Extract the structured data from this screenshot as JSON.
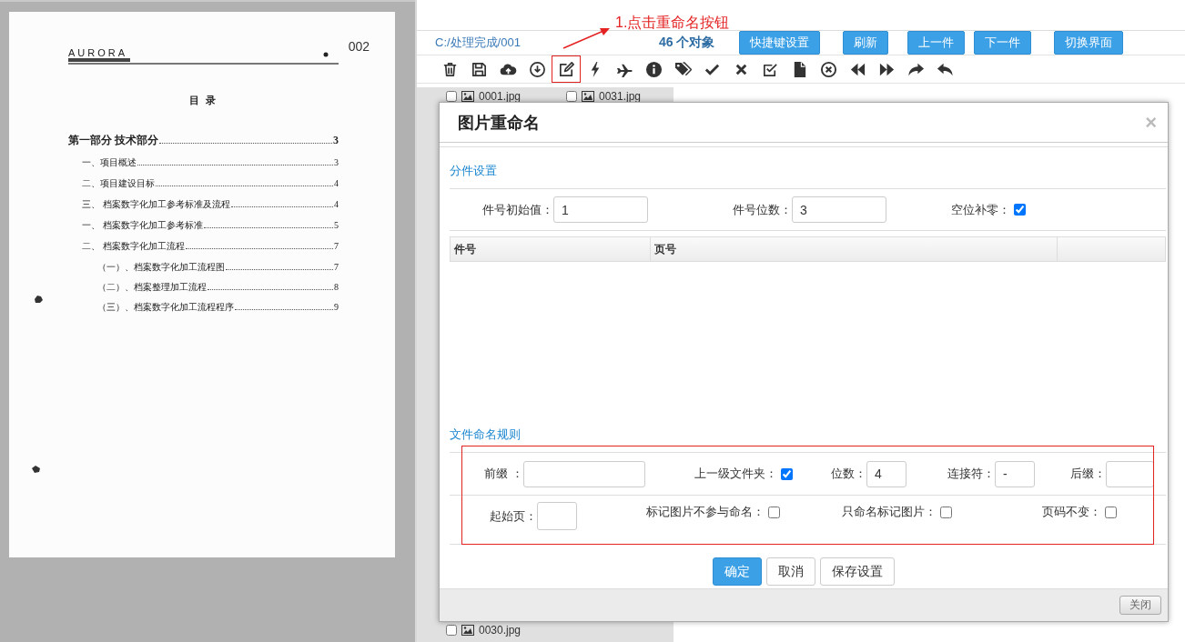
{
  "document_preview": {
    "logo": "AURORA",
    "page_number": "002",
    "title": "目 录",
    "toc": [
      {
        "text": "第一部分 技术部分",
        "page": "3",
        "children": [
          {
            "text": "一、项目概述",
            "page": "3"
          },
          {
            "text": "二、项目建设目标",
            "page": "4"
          },
          {
            "text": "三、 档案数字化加工参考标准及流程",
            "page": "4"
          },
          {
            "text": "一、 档案数字化加工参考标准",
            "page": "5"
          },
          {
            "text": "二、 档案数字化加工流程",
            "page": "7",
            "children": [
              {
                "text": "（一）、档案数字化加工流程图",
                "page": "7"
              },
              {
                "text": "（二）、档案整理加工流程",
                "page": "8"
              },
              {
                "text": "（三）、档案数字化加工流程程序",
                "page": "9"
              }
            ]
          }
        ]
      }
    ]
  },
  "annotation": {
    "text": "1.点击重命名按钮"
  },
  "path": "C:/处理完成/001",
  "count": "46 个对象",
  "buttons": [
    "快捷键设置",
    "刷新",
    "上一件",
    "下一件",
    "切换界面"
  ],
  "toolbar": [
    {
      "kind": "trash",
      "highlighted": false
    },
    {
      "kind": "save",
      "highlighted": false
    },
    {
      "kind": "upload",
      "highlighted": false
    },
    {
      "kind": "download",
      "highlighted": false
    },
    {
      "kind": "edit",
      "highlighted": true
    },
    {
      "kind": "bolt",
      "highlighted": false
    },
    {
      "kind": "plane",
      "highlighted": false
    },
    {
      "kind": "info",
      "highlighted": false
    },
    {
      "kind": "tag",
      "highlighted": false
    },
    {
      "kind": "check",
      "highlighted": false
    },
    {
      "kind": "times",
      "highlighted": false
    },
    {
      "kind": "checksquare",
      "highlighted": false
    },
    {
      "kind": "file",
      "highlighted": false
    },
    {
      "kind": "timescircle",
      "highlighted": false
    },
    {
      "kind": "backward",
      "highlighted": false
    },
    {
      "kind": "forward",
      "highlighted": false
    },
    {
      "kind": "redo",
      "highlighted": false
    },
    {
      "kind": "undo",
      "highlighted": false
    }
  ],
  "files_top": [
    {
      "name": "0001.jpg",
      "checked": false
    },
    {
      "name": "0031.jpg",
      "checked": false
    }
  ],
  "files_bottom": [
    {
      "name": "0030.jpg",
      "checked": false
    }
  ],
  "dialog": {
    "title": "图片重命名",
    "close": "×",
    "section_1": {
      "title": "分件设置",
      "fields": [
        {
          "kind": "text",
          "label": "件号初始值：",
          "value": "1"
        },
        {
          "kind": "text",
          "label": "件号位数：",
          "value": "3"
        },
        {
          "kind": "checkbox",
          "label": "空位补零：",
          "checked": true
        }
      ],
      "table": {
        "columns": [
          "件号",
          "页号"
        ]
      }
    },
    "section_2": {
      "title": "文件命名规则",
      "highlighted": true,
      "lines": [
        {
          "fields": [
            {
              "kind": "text",
              "label": "前缀 ："
            },
            {
              "kind": "checkbox",
              "label": "上一级文件夹：",
              "checked": true
            },
            {
              "kind": "text",
              "label": "位数：",
              "value": "4"
            },
            {
              "kind": "text",
              "label": "连接符：",
              "value": "-"
            },
            {
              "kind": "text",
              "label": "后缀："
            }
          ]
        },
        {
          "fields": [
            {
              "kind": "text",
              "label": "起始页："
            },
            {
              "kind": "checkbox",
              "label": "标记图片不参与命名：",
              "checked": false
            },
            {
              "kind": "checkbox",
              "label": "只命名标记图片：",
              "checked": false
            },
            {
              "kind": "checkbox",
              "label": "页码不变：",
              "checked": false
            }
          ]
        }
      ]
    },
    "actions": [
      {
        "label": "确定",
        "primary": true
      },
      {
        "label": "取消",
        "primary": false
      },
      {
        "label": "保存设置",
        "primary": false
      }
    ],
    "close_button": "关闭"
  }
}
